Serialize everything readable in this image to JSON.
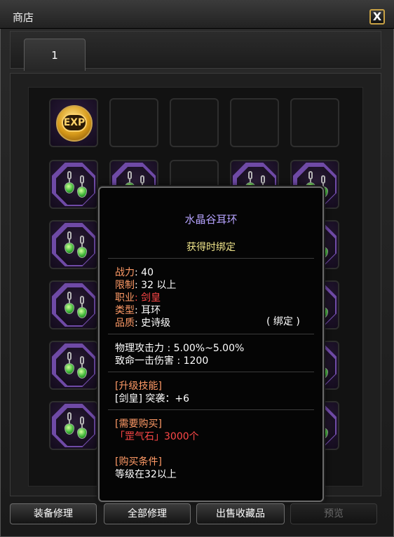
{
  "window": {
    "title": "商店",
    "close_label": "X"
  },
  "tabs": [
    {
      "label": "1"
    }
  ],
  "grid": {
    "exp_label": "EXP",
    "rows": [
      [
        "exp",
        "empty",
        "empty",
        "empty",
        "empty"
      ],
      [
        "earring",
        "earring",
        "empty",
        "earring",
        "earring"
      ],
      [
        "earring",
        "hidden",
        "hidden",
        "hidden",
        "earring"
      ],
      [
        "earring",
        "hidden",
        "hidden",
        "hidden",
        "earring"
      ],
      [
        "earring",
        "hidden",
        "hidden",
        "hidden",
        "earring"
      ],
      [
        "earring",
        "hidden",
        "hidden",
        "hidden",
        "earring"
      ]
    ]
  },
  "tooltip": {
    "name": "水晶谷耳环",
    "bind_text": "获得时绑定",
    "stats": {
      "power_label": "战力",
      "power_value": ": 40",
      "limit_label": "限制",
      "limit_value": ":  32 以上",
      "class_label": "职业",
      "class_value": ":  剑皇",
      "type_label": "类型",
      "type_value": ":  耳环",
      "quality_label": "品质",
      "quality_value": ":  史诗级",
      "bound_tag": "( 绑定 )"
    },
    "attributes": {
      "phys_attack": "物理攻击力 : 5.00%~5.00%",
      "crit_damage": "致命一击伤害 : 1200"
    },
    "skill": {
      "header": "[升级技能]",
      "line": "[剑皇] 突袭：+6"
    },
    "requirement": {
      "header": "[需要购买]",
      "line": "「罡气石」3000个"
    },
    "condition": {
      "header": "[购买条件]",
      "line": "等级在32以上"
    }
  },
  "buttons": {
    "repair": "装备修理",
    "repair_all": "全部修理",
    "sell_collection": "出售收藏品",
    "preview": "预览"
  },
  "colors": {
    "item_name": "#b6a3ff",
    "bind": "#f0e58b",
    "stat_label": "#ff9a66",
    "required": "#ff4848"
  },
  "icons": {
    "close": "close-icon",
    "exp": "exp-coin-icon",
    "item": "green-crystal-earring-icon"
  }
}
